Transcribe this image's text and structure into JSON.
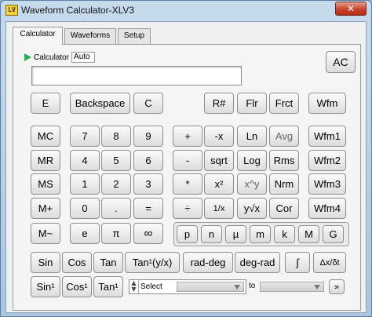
{
  "window": {
    "title": "Waveform Calculator-XLV3",
    "icon": "LV",
    "close": "✕"
  },
  "tabs": [
    "Calculator",
    "Waveforms",
    "Setup"
  ],
  "calc": {
    "label": "Calculator",
    "mode_value": "Auto",
    "display_value": ""
  },
  "buttons": {
    "ac": "AC",
    "e_upper": "E",
    "backspace": "Backspace",
    "c": "C",
    "r_hash": "R#",
    "flr": "Flr",
    "frct": "Frct",
    "wfm": "Wfm",
    "mc": "MC",
    "mr": "MR",
    "ms": "MS",
    "m_plus": "M+",
    "m_tilde": "M~",
    "n7": "7",
    "n8": "8",
    "n9": "9",
    "n4": "4",
    "n5": "5",
    "n6": "6",
    "n1": "1",
    "n2": "2",
    "n3": "3",
    "n0": "0",
    "dot": ".",
    "eq": "=",
    "e_lower": "e",
    "pi": "π",
    "inf": "∞",
    "plus": "+",
    "neg_x": "-x",
    "ln": "Ln",
    "avg": "Avg",
    "wfm1": "Wfm1",
    "minus": "-",
    "sqrt": "sqrt",
    "log": "Log",
    "rms": "Rms",
    "wfm2": "Wfm2",
    "times": "*",
    "x_sq": "x²",
    "x_pow_y": "x^y",
    "nrm": "Nrm",
    "wfm3": "Wfm3",
    "divide": "÷",
    "recip": "1/x",
    "y_root_x": "y√x",
    "cor": "Cor",
    "wfm4": "Wfm4",
    "sin": "Sin",
    "cos": "Cos",
    "tan": "Tan",
    "tan_inv_yx": "Tan¹(y/x)",
    "rad_deg": "rad-deg",
    "deg_rad": "deg-rad",
    "integral": "∫",
    "dx_dt": "Δx/δt",
    "sin_inv": "Sin¹",
    "cos_inv": "Cos¹",
    "tan_inv": "Tan¹",
    "next": "»"
  },
  "constants": [
    "p",
    "n",
    "µ",
    "m",
    "k",
    "M",
    "G"
  ],
  "range": {
    "select_value": "Select",
    "to_label": "to"
  }
}
